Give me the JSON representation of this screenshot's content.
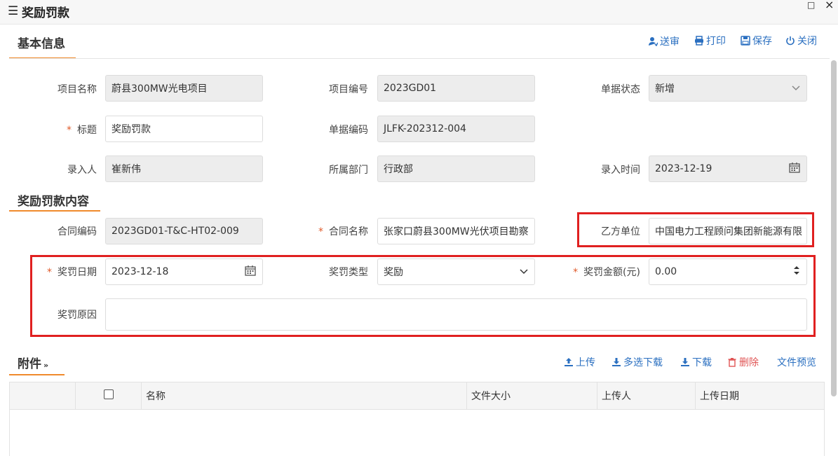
{
  "window": {
    "title": "奖励罚款",
    "menu_icon": "☰",
    "max_icon": "□",
    "close_icon": "×"
  },
  "toolbar": {
    "send": "送审",
    "print": "打印",
    "save": "保存",
    "close": "关闭"
  },
  "sections": {
    "basic": "基本信息",
    "content": "奖励罚款内容",
    "attachments": "附件"
  },
  "basic": {
    "project_name": {
      "label": "项目名称",
      "value": "蔚县300MW光电项目"
    },
    "project_no": {
      "label": "项目编号",
      "value": "2023GD01"
    },
    "doc_status": {
      "label": "单据状态",
      "value": "新增"
    },
    "title": {
      "label": "标题",
      "value": "奖励罚款"
    },
    "doc_no": {
      "label": "单据编码",
      "value": "JLFK-202312-004"
    },
    "entered_by": {
      "label": "录入人",
      "value": "崔新伟"
    },
    "department": {
      "label": "所属部门",
      "value": "行政部"
    },
    "entry_time": {
      "label": "录入时间",
      "value": "2023-12-19"
    }
  },
  "content": {
    "contract_no": {
      "label": "合同编码",
      "value": "2023GD01-T&C-HT02-009"
    },
    "contract_name": {
      "label": "合同名称",
      "value": "张家口蔚县300MW光伏项目勘察"
    },
    "party_b": {
      "label": "乙方单位",
      "value": "中国电力工程顾问集团新能源有限"
    },
    "date": {
      "label": "奖罚日期",
      "value": "2023-12-18"
    },
    "type": {
      "label": "奖罚类型",
      "value": "奖励"
    },
    "amount": {
      "label": "奖罚金额(元)",
      "value": "0.00"
    },
    "reason": {
      "label": "奖罚原因",
      "value": ""
    }
  },
  "required_mark": "*",
  "attachments": {
    "upload": "上传",
    "multi_download": "多选下载",
    "download": "下载",
    "delete": "删除",
    "preview": "文件预览",
    "columns": [
      "名称",
      "文件大小",
      "上传人",
      "上传日期"
    ]
  }
}
